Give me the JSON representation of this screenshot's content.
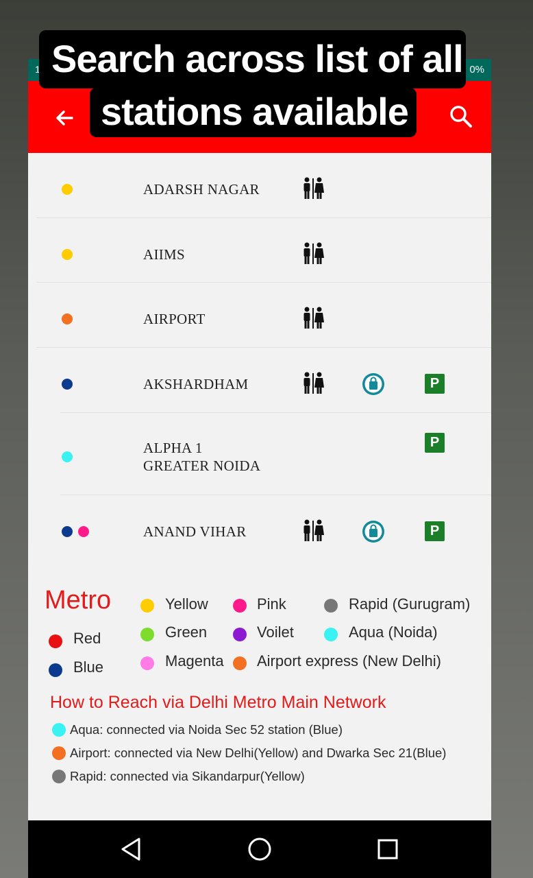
{
  "overlay": {
    "line1": "Search across list of all",
    "line2": "stations available"
  },
  "status": {
    "left": "1",
    "battery": "0%"
  },
  "appbar": {
    "back_icon": "arrow-left-icon",
    "search_icon": "search-icon"
  },
  "stations": [
    {
      "name": "ADARSH NAGAR",
      "lines": [
        "#ffcc00"
      ],
      "toilet": true,
      "bag": false,
      "parking": false
    },
    {
      "name": "AIIMS",
      "lines": [
        "#ffcc00"
      ],
      "toilet": true,
      "bag": false,
      "parking": false
    },
    {
      "name": "AIRPORT",
      "lines": [
        "#f36f21"
      ],
      "toilet": true,
      "bag": false,
      "parking": false
    },
    {
      "name": "AKSHARDHAM",
      "lines": [
        "#0b3a8f"
      ],
      "toilet": true,
      "bag": true,
      "parking": true
    },
    {
      "name_line1": "ALPHA 1",
      "name_line2": "GREATER NOIDA",
      "lines": [
        "#3af2f2"
      ],
      "toilet": false,
      "bag": false,
      "parking": true
    },
    {
      "name": "ANAND VIHAR",
      "lines": [
        "#0b3a8f",
        "#ff1a8c"
      ],
      "toilet": true,
      "bag": true,
      "parking": true
    }
  ],
  "parking_label": "P",
  "legend": {
    "title": "Metro",
    "items": [
      {
        "label": "Yellow",
        "color": "#ffcc00"
      },
      {
        "label": "Pink",
        "color": "#ff1a8c"
      },
      {
        "label": "Rapid (Gurugram)",
        "color": "#777777"
      },
      {
        "label": "Red",
        "color": "#e81010"
      },
      {
        "label": "Green",
        "color": "#7ddc2c"
      },
      {
        "label": "Voilet",
        "color": "#8b1ad0"
      },
      {
        "label": "Aqua (Noida)",
        "color": "#3af2f2"
      },
      {
        "label": "Blue",
        "color": "#0b3a8f"
      },
      {
        "label": "Magenta",
        "color": "#ff7be6"
      },
      {
        "label": "Airport express (New Delhi)",
        "color": "#f36f21"
      }
    ]
  },
  "reach": {
    "title": "How to Reach via Delhi Metro Main Network",
    "items": [
      {
        "text": "Aqua: connected via Noida Sec 52 station (Blue)",
        "color": "#3af2f2"
      },
      {
        "text": "Airport: connected via New Delhi(Yellow) and Dwarka Sec 21(Blue)",
        "color": "#f36f21"
      },
      {
        "text": "Rapid: connected via Sikandarpur(Yellow)",
        "color": "#777777"
      }
    ]
  },
  "navbar": {
    "back": "triangle-back-icon",
    "home": "circle-home-icon",
    "recents": "square-recents-icon"
  }
}
